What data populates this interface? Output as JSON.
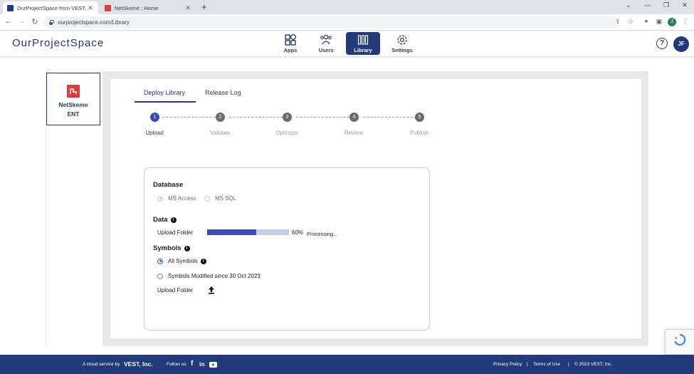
{
  "browser": {
    "tabs": [
      {
        "title": "OurProjectSpace from VEST, Inc."
      },
      {
        "title": "NetSkeme : Home"
      }
    ],
    "url": "ourprojectspace.com/Library",
    "profile_initial": "J"
  },
  "header": {
    "logo": "OurProjectSpace",
    "nav": [
      {
        "label": "Apps",
        "icon": "apps-icon"
      },
      {
        "label": "Users",
        "icon": "users-icon"
      },
      {
        "label": "Library",
        "icon": "library-icon",
        "active": true
      },
      {
        "label": "Settings",
        "icon": "gear-icon"
      }
    ],
    "help": "?",
    "avatar": "JF"
  },
  "database_card": {
    "name_line1": "NetSkeme",
    "name_line2": "ENT"
  },
  "page_tabs": [
    {
      "label": "Deploy Library",
      "active": true
    },
    {
      "label": "Release Log"
    }
  ],
  "stepper": [
    {
      "num": "1",
      "label": "Upload",
      "current": true
    },
    {
      "num": "2",
      "label": "Validate"
    },
    {
      "num": "3",
      "label": "Optimize"
    },
    {
      "num": "4",
      "label": "Review"
    },
    {
      "num": "5",
      "label": "Publish"
    }
  ],
  "form": {
    "database_title": "Database",
    "db_options": [
      "MS Access",
      "MS SQL"
    ],
    "data_title": "Data",
    "upload_folder_label": "Upload Folder",
    "progress_percent": 60,
    "progress_text": "60%",
    "processing_text": "Processing...",
    "symbols_title": "Symbols",
    "symbol_options": [
      "All Symbols",
      "Symbols Modified since 30 Oct 2023"
    ],
    "symbols_upload_label": "Upload Folder"
  },
  "footer": {
    "cloud_text": "A cloud service by",
    "company": "VEST, Inc.",
    "follow": "Follow us",
    "privacy": "Privacy Policy",
    "terms": "Terms of Use",
    "copyright": "© 2023 VEST, Inc."
  },
  "colors": {
    "brand_navy": "#233a7a",
    "progress_fill": "#3b4bb0",
    "progress_track": "#c9cce6"
  }
}
